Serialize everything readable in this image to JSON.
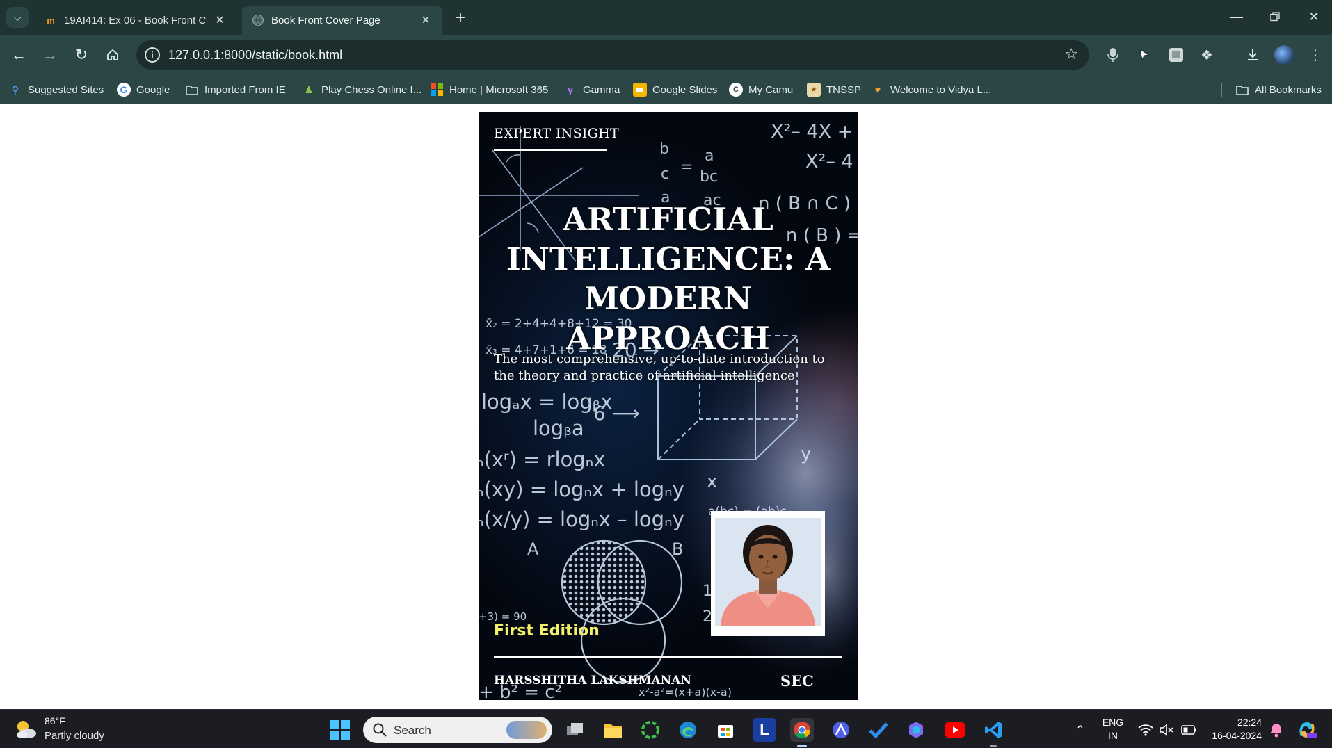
{
  "browser": {
    "tabs": [
      {
        "title": "19AI414: Ex 06 - Book Front Co",
        "favicon": "moodle-icon",
        "active": false
      },
      {
        "title": "Book Front Cover Page",
        "favicon": "globe-icon",
        "active": true
      }
    ],
    "url": "127.0.0.1:8000/static/book.html",
    "bookmarks": [
      {
        "label": "Suggested Sites",
        "icon": "search-icon"
      },
      {
        "label": "Google",
        "icon": "google-icon"
      },
      {
        "label": "Imported From IE",
        "icon": "folder-icon"
      },
      {
        "label": "Play Chess Online f...",
        "icon": "chess-pawn-icon"
      },
      {
        "label": "Home | Microsoft 365",
        "icon": "microsoft-icon"
      },
      {
        "label": "Gamma",
        "icon": "gamma-icon"
      },
      {
        "label": "Google Slides",
        "icon": "slides-icon"
      },
      {
        "label": "My Camu",
        "icon": "camu-icon"
      },
      {
        "label": "TNSSP",
        "icon": "tnssp-icon"
      },
      {
        "label": "Welcome to Vidya L...",
        "icon": "vidya-icon"
      }
    ],
    "all_bookmarks": "All Bookmarks"
  },
  "cover": {
    "series": "EXPERT INSIGHT",
    "title": "ARTIFICIAL INTELLIGENCE: A MODERN APPROACH",
    "subtitle": "The most comprehensive, up-to-date introduction to the theory and practice of artificial intelligence",
    "edition": "First Edition",
    "author": "HARSSHITHA LAKSHMANAN",
    "publisher": "SEC",
    "formulas": [
      "X²– 4X +",
      "X²– 4",
      "n ( B ∩ C ) =",
      "n ( B )  =",
      "x̄₂ = 2+4+4+8+12 = 30",
      "x̄₃ = 4+7+1+6 = 18",
      "logₐx = logᵦx",
      "logᵦa",
      "ₙ(xʳ) = rlogₙx",
      "ₙ(xy) = logₙx + logₙy",
      "ₙ(x/y) = logₙx – logₙy",
      "20 →",
      "6 ⟶",
      "A",
      "B",
      "x",
      "y",
      "1",
      "2",
      "+3)  = 90",
      "a(bc) = (ab)c",
      "x²-a²=(x+a)(x-a)",
      "+ b² = c²"
    ]
  },
  "taskbar": {
    "weather_temp": "86°F",
    "weather_desc": "Partly cloudy",
    "search_placeholder": "Search",
    "lang_top": "ENG",
    "lang_bottom": "IN",
    "time": "22:24",
    "date": "16-04-2024"
  },
  "colors": {
    "chrome_bg": "#1f3333",
    "toolbar_bg": "#2c4646",
    "edition_yellow": "#f4f06a"
  }
}
